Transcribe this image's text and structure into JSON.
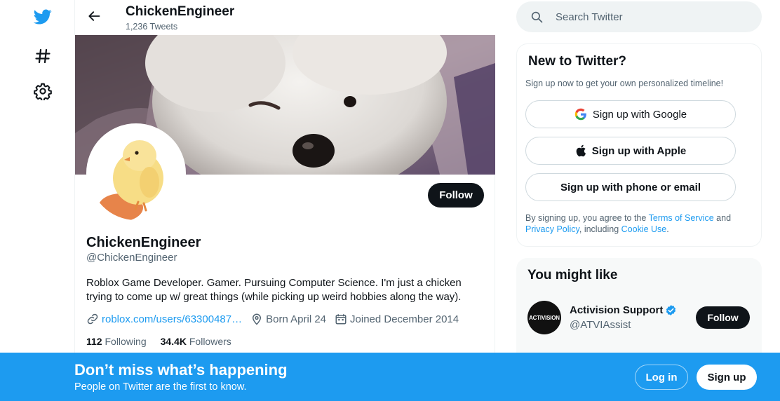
{
  "header": {
    "title": "ChickenEngineer",
    "tweet_count": "1,236 Tweets"
  },
  "profile": {
    "name": "ChickenEngineer",
    "handle": "@ChickenEngineer",
    "bio": "Roblox Game Developer. Gamer. Pursuing Computer Science. I'm just a chicken trying to come up w/ great things (while picking up weird hobbies along the way).",
    "link": "roblox.com/users/63300487…",
    "born": "Born April 24",
    "joined": "Joined December 2014",
    "following_count": "112",
    "following_label": "Following",
    "followers_count": "34.4K",
    "followers_label": "Followers",
    "follow_label": "Follow"
  },
  "search": {
    "placeholder": "Search Twitter"
  },
  "new_to_twitter": {
    "title": "New to Twitter?",
    "subtitle": "Sign up now to get your own personalized timeline!",
    "google": "Sign up with Google",
    "apple": "Sign up with Apple",
    "phone": "Sign up with phone or email",
    "terms_prefix": "By signing up, you agree to the ",
    "terms_link": "Terms of Service",
    "terms_and": " and ",
    "privacy_link": "Privacy Policy",
    "terms_including": ", including ",
    "cookie_link": "Cookie Use",
    "terms_end": "."
  },
  "you_might_like": {
    "title": "You might like",
    "items": [
      {
        "name": "Activision Support",
        "handle": "@ATVIAssist",
        "avatar_text": "ACTIVISION",
        "follow_label": "Follow"
      }
    ]
  },
  "bottom_bar": {
    "title": "Don’t miss what’s happening",
    "subtitle": "People on Twitter are the first to know.",
    "login": "Log in",
    "signup": "Sign up"
  },
  "colors": {
    "accent": "#1d9bf0",
    "dark": "#0f1419",
    "muted": "#536471"
  },
  "icons": [
    "twitter-bird-icon",
    "hashtag-icon",
    "settings-icon",
    "back-arrow-icon",
    "search-icon",
    "link-icon",
    "location-icon",
    "calendar-icon",
    "google-icon",
    "apple-icon",
    "verified-icon"
  ]
}
